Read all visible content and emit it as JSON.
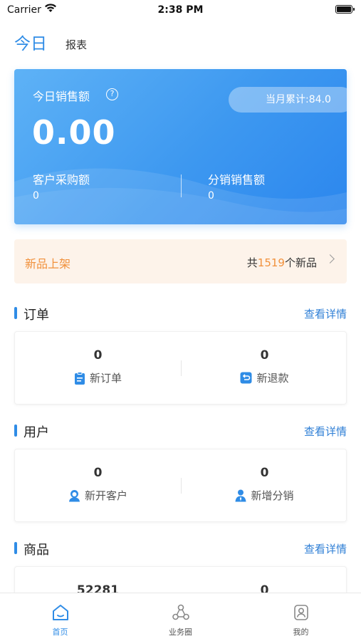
{
  "status_bar": {
    "carrier": "Carrier",
    "time": "2:38 PM"
  },
  "header": {
    "tabs": [
      {
        "label": "今日",
        "active": true
      },
      {
        "label": "报表",
        "active": false
      }
    ]
  },
  "sales_card": {
    "title": "今日销售额",
    "help_icon": "?",
    "monthly_total": "当月累计:84.0",
    "amount": "0.00",
    "customer_purchase_label": "客户采购额",
    "customer_purchase_value": "0",
    "distribution_sales_label": "分销销售额",
    "distribution_sales_value": "0"
  },
  "new_products": {
    "title": "新品上架",
    "prefix": "共",
    "count": "1519",
    "suffix": "个新品"
  },
  "sections": {
    "orders": {
      "title": "订单",
      "link": "查看详情",
      "left": {
        "value": "0",
        "label": "新订单",
        "icon": "clipboard-icon"
      },
      "right": {
        "value": "0",
        "label": "新退款",
        "icon": "refund-icon"
      }
    },
    "users": {
      "title": "用户",
      "link": "查看详情",
      "left": {
        "value": "0",
        "label": "新开客户",
        "icon": "customer-icon"
      },
      "right": {
        "value": "0",
        "label": "新增分销",
        "icon": "distributor-icon"
      }
    },
    "goods": {
      "title": "商品",
      "link": "查看详情",
      "left": {
        "value": "52281"
      },
      "right": {
        "value": "0"
      }
    }
  },
  "tab_bar": {
    "items": [
      {
        "label": "首页",
        "icon": "home-icon",
        "active": true
      },
      {
        "label": "业务圈",
        "icon": "business-circle-icon",
        "active": false
      },
      {
        "label": "我的",
        "icon": "profile-icon",
        "active": false
      }
    ]
  },
  "colors": {
    "accent": "#2f8ce6",
    "orange": "#f1913c",
    "banner_bg": "#fdf3ea"
  }
}
